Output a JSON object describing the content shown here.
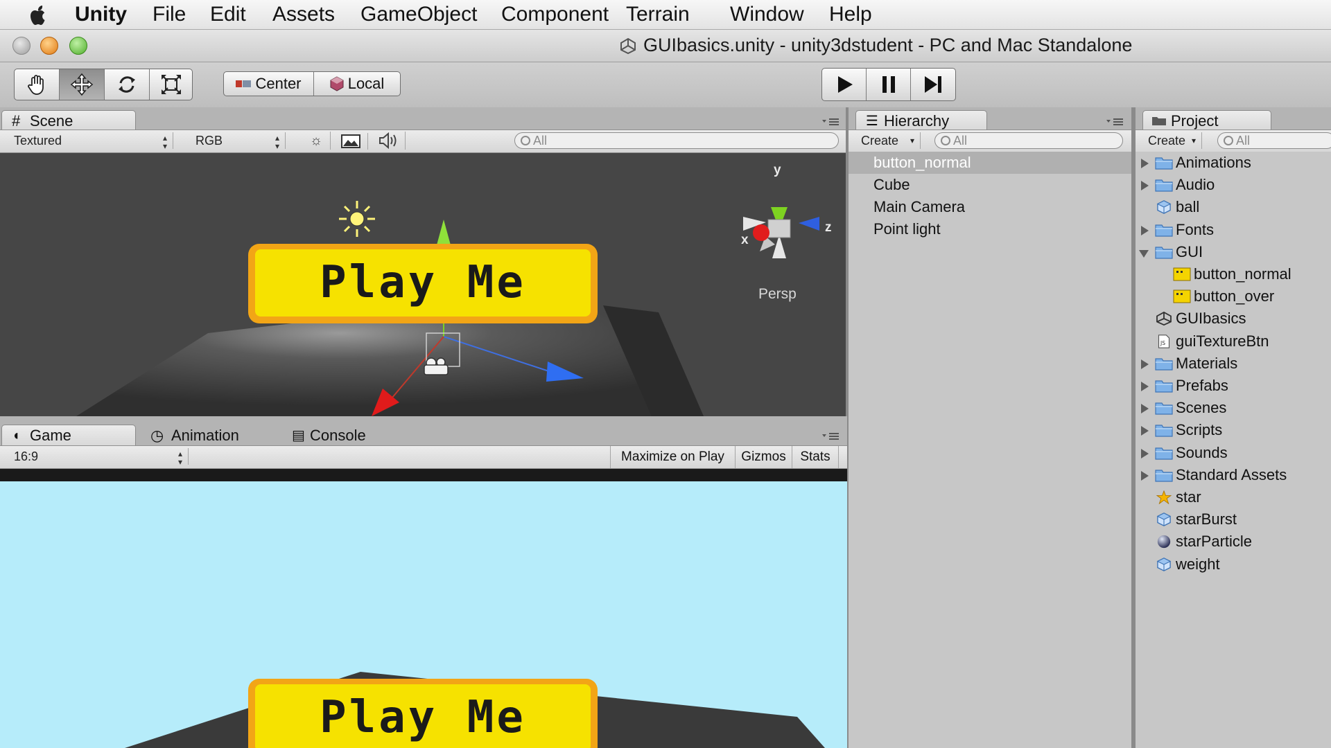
{
  "menubar": {
    "app_name": "Unity",
    "items": [
      "File",
      "Edit",
      "Assets",
      "GameObject",
      "Component",
      "Terrain",
      "Window",
      "Help"
    ]
  },
  "window": {
    "title": "GUIbasics.unity - unity3dstudent - PC and Mac Standalone"
  },
  "toolbar": {
    "pivot_center_label": "Center",
    "pivot_local_label": "Local"
  },
  "scene": {
    "tab_label": "Scene",
    "draw_mode": "Textured",
    "render_mode": "RGB",
    "search_placeholder": "All",
    "gizmo_label": "Persp",
    "gizmo_axes": {
      "x": "x",
      "y": "y",
      "z": "z"
    },
    "button_text": "Play Me"
  },
  "bottom_tabs": {
    "game": "Game",
    "animation": "Animation",
    "console": "Console"
  },
  "game": {
    "aspect": "16:9",
    "maximize_label": "Maximize on Play",
    "gizmos_label": "Gizmos",
    "stats_label": "Stats",
    "button_text": "Play Me"
  },
  "hierarchy": {
    "tab_label": "Hierarchy",
    "create_label": "Create",
    "search_placeholder": "All",
    "items": [
      "button_normal",
      "Cube",
      "Main Camera",
      "Point light"
    ],
    "selected_index": 0
  },
  "project": {
    "tab_label": "Project",
    "create_label": "Create",
    "search_placeholder": "All",
    "items": [
      {
        "label": "Animations",
        "icon": "folder-icon",
        "expandable": true
      },
      {
        "label": "Audio",
        "icon": "folder-icon",
        "expandable": true
      },
      {
        "label": "ball",
        "icon": "prefab-cube-icon",
        "expandable": false
      },
      {
        "label": "Fonts",
        "icon": "folder-icon",
        "expandable": true
      },
      {
        "label": "GUI",
        "icon": "folder-icon",
        "expandable": true,
        "expanded": true
      },
      {
        "label": "button_normal",
        "icon": "texture-icon",
        "expandable": false,
        "child": true
      },
      {
        "label": "button_over",
        "icon": "texture-icon",
        "expandable": false,
        "child": true
      },
      {
        "label": "GUIbasics",
        "icon": "unity-scene-icon",
        "expandable": false
      },
      {
        "label": "guiTextureBtn",
        "icon": "script-icon",
        "expandable": false
      },
      {
        "label": "Materials",
        "icon": "folder-icon",
        "expandable": true
      },
      {
        "label": "Prefabs",
        "icon": "folder-icon",
        "expandable": true
      },
      {
        "label": "Scenes",
        "icon": "folder-icon",
        "expandable": true
      },
      {
        "label": "Scripts",
        "icon": "folder-icon",
        "expandable": true
      },
      {
        "label": "Sounds",
        "icon": "folder-icon",
        "expandable": true
      },
      {
        "label": "Standard Assets",
        "icon": "folder-icon",
        "expandable": true
      },
      {
        "label": "star",
        "icon": "star-icon",
        "expandable": false
      },
      {
        "label": "starBurst",
        "icon": "prefab-cube-icon",
        "expandable": false
      },
      {
        "label": "starParticle",
        "icon": "sphere-icon",
        "expandable": false
      },
      {
        "label": "weight",
        "icon": "prefab-cube-icon",
        "expandable": false
      }
    ]
  },
  "colors": {
    "game_background": "#b6ecfa",
    "scene_background": "#464646",
    "button_yellow": "#f6e200",
    "button_border": "#f2a516"
  }
}
